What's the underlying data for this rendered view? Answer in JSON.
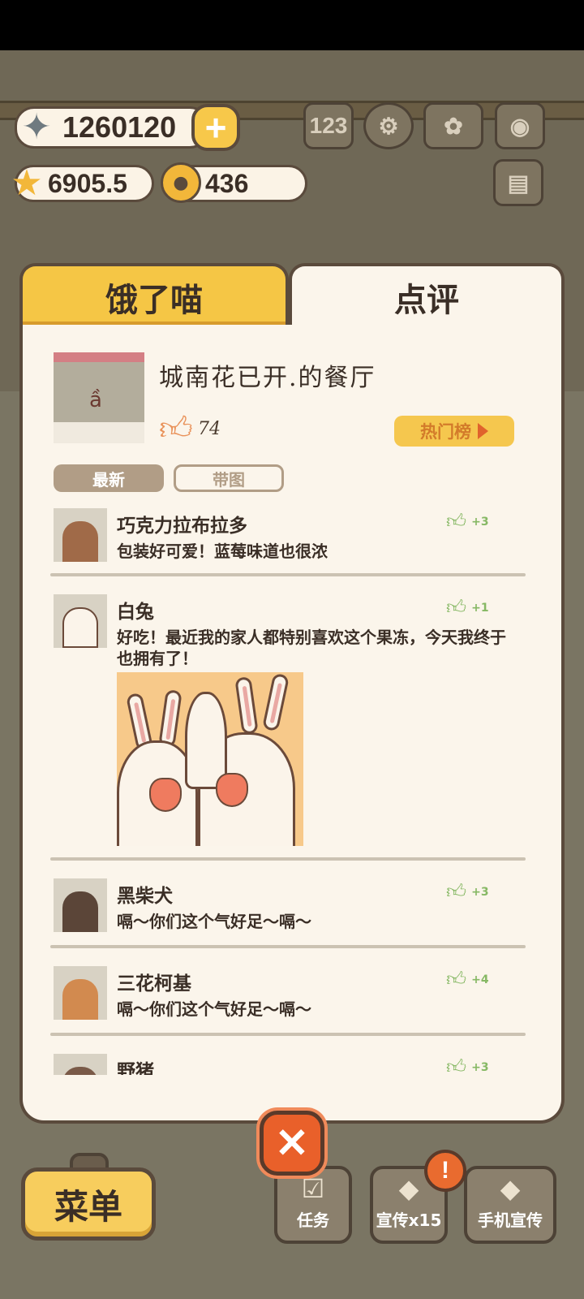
{
  "currencies": {
    "fish": "1260120",
    "stars": "6905.5",
    "bells": "436"
  },
  "icons": {
    "fish": "fish-icon",
    "star": "star-icon",
    "bell": "bell-icon",
    "plus": "+",
    "ranking": "ranking-icon",
    "settings": "gear-icon",
    "book": "paw-book-icon",
    "camera": "camera-icon",
    "news": "newspaper-icon"
  },
  "tabs": {
    "hungry": "饿了喵",
    "review": "点评"
  },
  "restaurant": {
    "name": "城南花已开.的餐厅",
    "likes": "74",
    "hot_list": "热门榜"
  },
  "filters": {
    "newest": "最新",
    "with_pics": "带图"
  },
  "reviews": [
    {
      "name": "巧克力拉布拉多",
      "text": "包装好可爱！蓝莓味道也很浓",
      "likes": "+3"
    },
    {
      "name": "白兔",
      "text": "好吃！最近我的家人都特别喜欢这个果冻，今天我终于也拥有了！",
      "likes": "+1"
    },
    {
      "name": "黑柴犬",
      "text": "嗝～你们这个气好足～嗝～",
      "likes": "+3"
    },
    {
      "name": "三花柯基",
      "text": "嗝～你们这个气好足～嗝～",
      "likes": "+4"
    },
    {
      "name": "野猪",
      "text": "",
      "likes": "+3"
    }
  ],
  "bottom": {
    "menu": "菜单",
    "tasks": "任务",
    "promote": "宣传x15",
    "phone_promote": "手机宣传",
    "close": "✕",
    "alert": "!"
  },
  "colors": {
    "accent_yellow": "#f5c645",
    "panel": "#fbf5eb",
    "outline": "#5a4a3c",
    "like_green": "#86b864",
    "close_orange": "#e9602a"
  }
}
